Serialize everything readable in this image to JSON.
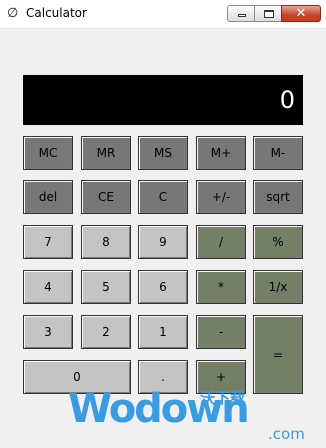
{
  "window": {
    "title": "Calculator",
    "app_icon": "feather-icon",
    "controls": {
      "minimize": "minimize-icon",
      "maximize": "maximize-icon",
      "close": "✕"
    }
  },
  "display": {
    "value": "0"
  },
  "buttons": {
    "mc": "MC",
    "mr": "MR",
    "ms": "MS",
    "mplus": "M+",
    "mminus": "M-",
    "del": "del",
    "ce": "CE",
    "c": "C",
    "plusminus": "+/-",
    "sqrt": "sqrt",
    "n7": "7",
    "n8": "8",
    "n9": "9",
    "divide": "/",
    "percent": "%",
    "n4": "4",
    "n5": "5",
    "n6": "6",
    "multiply": "*",
    "reciprocal": "1/x",
    "n3": "3",
    "n2": "2",
    "n1": "1",
    "minus": "-",
    "equals": "=",
    "n0": "0",
    "dot": ".",
    "plus": "+"
  },
  "colors": {
    "dark": "#777777",
    "light": "#c4c4c4",
    "green": "#738067",
    "display_bg": "#000000"
  },
  "watermark": {
    "logo": "Wodown",
    "cn": "沃下载",
    "com": ".com"
  }
}
